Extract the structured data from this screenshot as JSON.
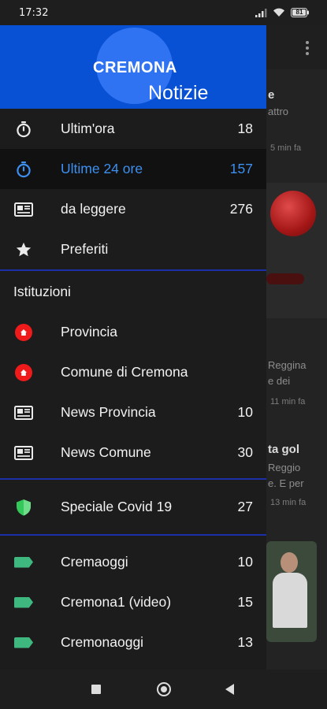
{
  "status_bar": {
    "time": "17:32",
    "battery": "81",
    "icons": [
      "signal-icon",
      "wifi-icon",
      "battery-icon"
    ]
  },
  "background_app": {
    "fragments": [
      {
        "text": "e",
        "kind": "title"
      },
      {
        "text": "attro",
        "kind": "text"
      },
      {
        "text": "5 min fa",
        "kind": "time"
      },
      {
        "text": "Reggina",
        "kind": "text"
      },
      {
        "text": "e dei",
        "kind": "text"
      },
      {
        "text": "11 min fa",
        "kind": "time"
      },
      {
        "text": "ta gol",
        "kind": "title"
      },
      {
        "text": "Reggio",
        "kind": "text"
      },
      {
        "text": "e. E per",
        "kind": "text"
      },
      {
        "text": "13 min fa",
        "kind": "time"
      }
    ]
  },
  "drawer": {
    "header": {
      "title": "CREMONA",
      "subtitle": "Notizie",
      "background_color": "#0850d4",
      "circle_color": "#2f73f2"
    },
    "main_items": [
      {
        "label": "Ultim'ora",
        "count": "18",
        "icon": "stopwatch-icon",
        "active": false
      },
      {
        "label": "Ultime 24 ore",
        "count": "157",
        "icon": "stopwatch-icon",
        "active": true
      },
      {
        "label": "da leggere",
        "count": "276",
        "icon": "newspaper-icon",
        "active": false
      },
      {
        "label": "Preferiti",
        "count": "",
        "icon": "star-icon",
        "active": false
      }
    ],
    "institutions_header": "Istituzioni",
    "institution_items": [
      {
        "label": "Provincia",
        "count": "",
        "icon": "home-icon"
      },
      {
        "label": "Comune di Cremona",
        "count": "",
        "icon": "home-icon"
      },
      {
        "label": "News Provincia",
        "count": "10",
        "icon": "newspaper-icon"
      },
      {
        "label": "News Comune",
        "count": "30",
        "icon": "newspaper-icon"
      }
    ],
    "special_items": [
      {
        "label": "Speciale Covid 19",
        "count": "27",
        "icon": "shield-icon"
      }
    ],
    "source_items": [
      {
        "label": "Cremaoggi",
        "count": "10",
        "icon": "tag-icon"
      },
      {
        "label": "Cremona1 (video)",
        "count": "15",
        "icon": "tag-icon"
      },
      {
        "label": "Cremonaoggi",
        "count": "13",
        "icon": "tag-icon"
      }
    ],
    "colors": {
      "active_text": "#3d8ff0",
      "divider": "#1a2fa8",
      "institution_icon": "#ef1b1b",
      "source_tag": "#3fb880",
      "shield": "#34c759"
    }
  },
  "nav_bar": {
    "buttons": [
      "recents-button",
      "home-button",
      "back-button"
    ]
  }
}
